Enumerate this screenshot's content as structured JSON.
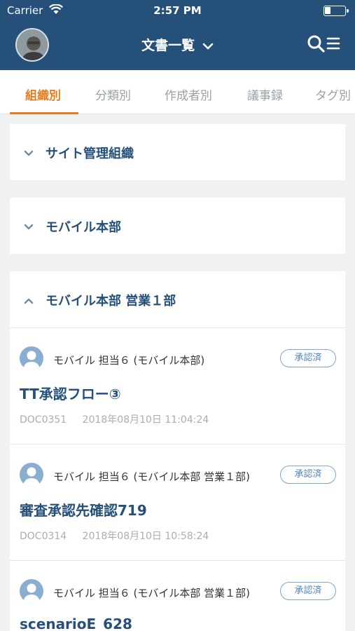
{
  "status_bar": {
    "carrier": "Carrier",
    "time": "2:57 PM"
  },
  "header": {
    "title": "文書一覧"
  },
  "tabs": [
    {
      "label": "組織別",
      "active": true
    },
    {
      "label": "分類別",
      "active": false
    },
    {
      "label": "作成者別",
      "active": false
    },
    {
      "label": "議事録",
      "active": false
    },
    {
      "label": "タグ別",
      "active": false
    }
  ],
  "groups": [
    {
      "name": "サイト管理組織",
      "expanded": false
    },
    {
      "name": "モバイル本部",
      "expanded": false
    },
    {
      "name": "モバイル本部 営業１部",
      "expanded": true
    }
  ],
  "documents": [
    {
      "author": "モバイル 担当６ (モバイル本部)",
      "status": "承認済",
      "title": "TT承認フロー③",
      "doc_id": "DOC0351",
      "datetime": "2018年08月10日 11:04:24"
    },
    {
      "author": "モバイル 担当６ (モバイル本部 営業１部)",
      "status": "承認済",
      "title": "審査承認先確認719",
      "doc_id": "DOC0314",
      "datetime": "2018年08月10日 10:58:24"
    },
    {
      "author": "モバイル 担当６ (モバイル本部 営業１部)",
      "status": "承認済",
      "title": "scenarioE_628",
      "doc_id": "",
      "datetime": ""
    }
  ],
  "colors": {
    "header_bg": "#24507a",
    "accent": "#e47e1f",
    "badge": "#4d84c0"
  }
}
